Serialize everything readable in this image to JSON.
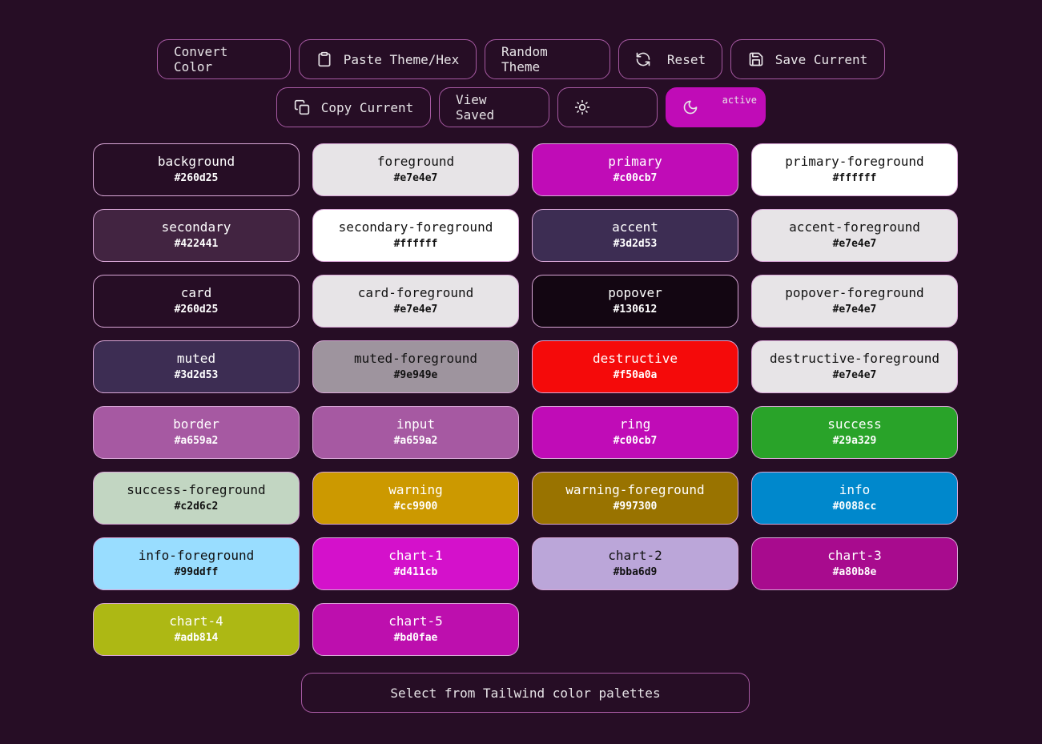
{
  "toolbar": {
    "convert_label": "Convert Color",
    "paste_label": "Paste Theme/Hex",
    "random_label": "Random Theme",
    "reset_label": "Reset",
    "save_label": "Save Current",
    "copy_label": "Copy Current",
    "view_saved_label": "View Saved",
    "dark_mode_badge": "active"
  },
  "swatches": [
    {
      "name": "background",
      "hex": "#260d25",
      "text": "#ffffff"
    },
    {
      "name": "foreground",
      "hex": "#e7e4e7",
      "text": "#111111"
    },
    {
      "name": "primary",
      "hex": "#c00cb7",
      "text": "#ffffff"
    },
    {
      "name": "primary-foreground",
      "hex": "#ffffff",
      "text": "#111111"
    },
    {
      "name": "secondary",
      "hex": "#422441",
      "text": "#ffffff"
    },
    {
      "name": "secondary-foreground",
      "hex": "#ffffff",
      "text": "#111111"
    },
    {
      "name": "accent",
      "hex": "#3d2d53",
      "text": "#ffffff"
    },
    {
      "name": "accent-foreground",
      "hex": "#e7e4e7",
      "text": "#111111"
    },
    {
      "name": "card",
      "hex": "#260d25",
      "text": "#ffffff"
    },
    {
      "name": "card-foreground",
      "hex": "#e7e4e7",
      "text": "#111111"
    },
    {
      "name": "popover",
      "hex": "#130612",
      "text": "#ffffff"
    },
    {
      "name": "popover-foreground",
      "hex": "#e7e4e7",
      "text": "#111111"
    },
    {
      "name": "muted",
      "hex": "#3d2d53",
      "text": "#ffffff"
    },
    {
      "name": "muted-foreground",
      "hex": "#9e949e",
      "text": "#111111"
    },
    {
      "name": "destructive",
      "hex": "#f50a0a",
      "text": "#ffffff"
    },
    {
      "name": "destructive-foreground",
      "hex": "#e7e4e7",
      "text": "#111111"
    },
    {
      "name": "border",
      "hex": "#a659a2",
      "text": "#ffffff"
    },
    {
      "name": "input",
      "hex": "#a659a2",
      "text": "#ffffff"
    },
    {
      "name": "ring",
      "hex": "#c00cb7",
      "text": "#ffffff"
    },
    {
      "name": "success",
      "hex": "#29a329",
      "text": "#ffffff"
    },
    {
      "name": "success-foreground",
      "hex": "#c2d6c2",
      "text": "#111111"
    },
    {
      "name": "warning",
      "hex": "#cc9900",
      "text": "#ffffff"
    },
    {
      "name": "warning-foreground",
      "hex": "#997300",
      "text": "#ffffff"
    },
    {
      "name": "info",
      "hex": "#0088cc",
      "text": "#ffffff"
    },
    {
      "name": "info-foreground",
      "hex": "#99ddff",
      "text": "#111111"
    },
    {
      "name": "chart-1",
      "hex": "#d411cb",
      "text": "#ffffff"
    },
    {
      "name": "chart-2",
      "hex": "#bba6d9",
      "text": "#111111"
    },
    {
      "name": "chart-3",
      "hex": "#a80b8e",
      "text": "#ffffff"
    },
    {
      "name": "chart-4",
      "hex": "#adb814",
      "text": "#ffffff"
    },
    {
      "name": "chart-5",
      "hex": "#bd0fae",
      "text": "#ffffff"
    }
  ],
  "palette_button_label": "Select from Tailwind color palettes"
}
